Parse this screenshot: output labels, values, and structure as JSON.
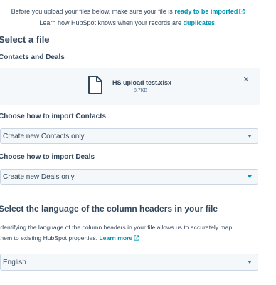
{
  "intro": {
    "line1_prefix": "Before you upload your files below, make sure your file is",
    "line1_link": "ready to be imported",
    "line2_prefix": "Learn how HubSpot knows when your records are",
    "line2_link": "duplicates",
    "line2_suffix": "."
  },
  "select_file": {
    "heading": "Select a file",
    "subheading": "Contacts and Deals",
    "file": {
      "name": "HS upload test.xlsx",
      "size": "8.7KB",
      "icon": "file-icon"
    }
  },
  "contacts_import": {
    "label": "Choose how to import Contacts",
    "selected": "Create new Contacts only"
  },
  "deals_import": {
    "label": "Choose how to import Deals",
    "selected": "Create new Deals only"
  },
  "language": {
    "heading": "Select the language of the column headers in your file",
    "help_line1": "Identifying the language of the column headers in your file allows us to accurately map",
    "help_line2": "them to existing HubSpot properties.",
    "learn_more": "Learn more",
    "selected": "English"
  },
  "colors": {
    "link": "#0091ae",
    "text": "#33475b",
    "panel": "#f5f8fa",
    "border": "#cbd6e2"
  }
}
